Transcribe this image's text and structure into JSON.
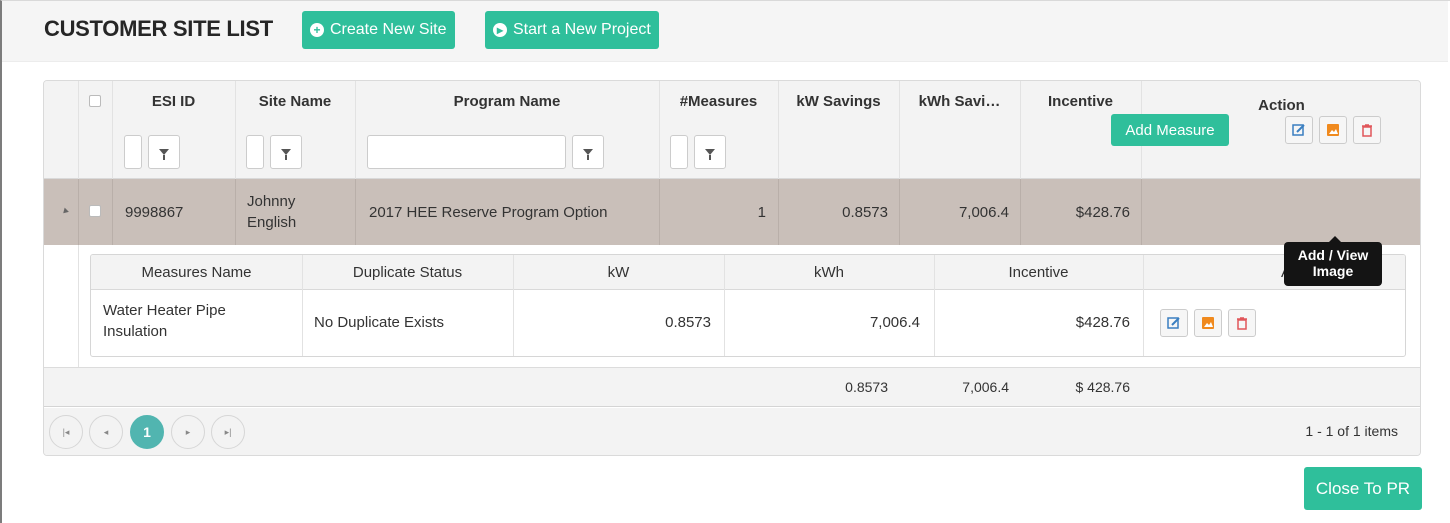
{
  "header": {
    "title": "CUSTOMER SITE LIST",
    "create_label": "Create New Site",
    "start_label": "Start a New Project"
  },
  "grid": {
    "columns": [
      "ESI ID",
      "Site Name",
      "Program Name",
      "#Measures",
      "kW Savings",
      "kWh Savi…",
      "Incentive",
      "Action"
    ],
    "row": {
      "esi_id": "9998867",
      "site_name_1": "Johnny",
      "site_name_2": "English",
      "program_name": "2017 HEE Reserve Program Option",
      "measures": "1",
      "kw_savings": "0.8573",
      "kwh_savings": "7,006.4",
      "incentive": "$428.76",
      "add_measure_label": "Add Measure"
    },
    "detail": {
      "columns": [
        "Measures Name",
        "Duplicate Status",
        "kW",
        "kWh",
        "Incentive",
        "Actio"
      ],
      "row": {
        "name_1": "Water Heater Pipe",
        "name_2": "Insulation",
        "duplicate_status": "No Duplicate Exists",
        "kw": "0.8573",
        "kwh": "7,006.4",
        "incentive": "$428.76"
      }
    },
    "totals": {
      "kw": "0.8573",
      "kwh": "7,006.4",
      "incentive": "$ 428.76"
    },
    "pager": {
      "current_page": "1",
      "info": "1 - 1 of 1 items"
    }
  },
  "tooltip": {
    "line1": "Add / View",
    "line2": "Image"
  },
  "close_label": "Close To PR",
  "colors": {
    "accent": "#2fbf9b",
    "selected_row": "#c9bfb9",
    "pager_active": "#51b5b0"
  }
}
